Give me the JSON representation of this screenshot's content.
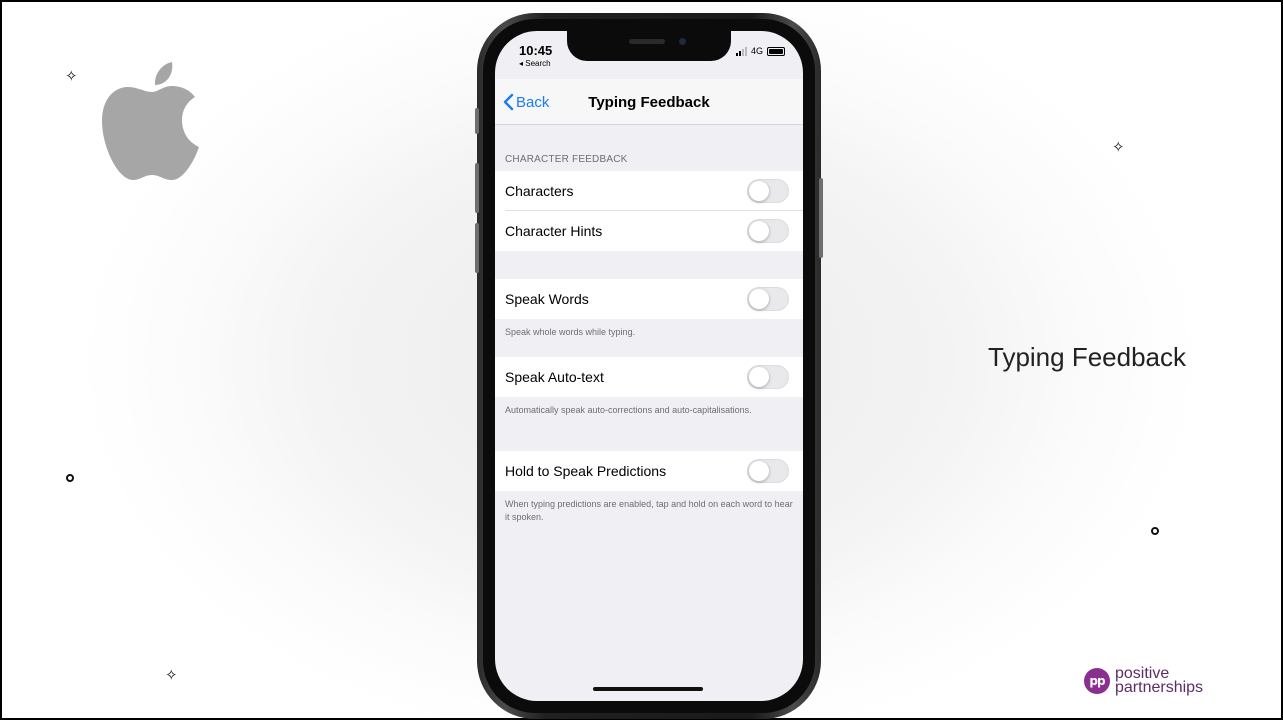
{
  "slide": {
    "title": "Typing Feedback",
    "brand_line1": "positive",
    "brand_line2": "partnerships",
    "brand_mark": "pp",
    "brand_color": "#8a2f8f"
  },
  "status_bar": {
    "time": "10:45",
    "back_to_app": "◂ Search",
    "network": "4G"
  },
  "nav": {
    "back_label": "Back",
    "title": "Typing Feedback",
    "accent_color": "#1a7cf5"
  },
  "settings": {
    "character_feedback_header": "CHARACTER FEEDBACK",
    "characters": {
      "label": "Characters",
      "on": false
    },
    "character_hints": {
      "label": "Character Hints",
      "on": false
    },
    "speak_words": {
      "label": "Speak Words",
      "on": false,
      "footer": "Speak whole words while typing."
    },
    "speak_auto_text": {
      "label": "Speak Auto-text",
      "on": false,
      "footer": "Automatically speak auto-corrections and auto-capitalisations."
    },
    "hold_to_speak": {
      "label": "Hold to Speak Predictions",
      "on": false,
      "footer": "When typing predictions are enabled, tap and hold on each word to hear it spoken."
    }
  },
  "icons": [
    "apple-logo",
    "sparkle-icon",
    "circle-dot-icon",
    "chevron-left-icon",
    "signal-icon",
    "battery-icon"
  ]
}
